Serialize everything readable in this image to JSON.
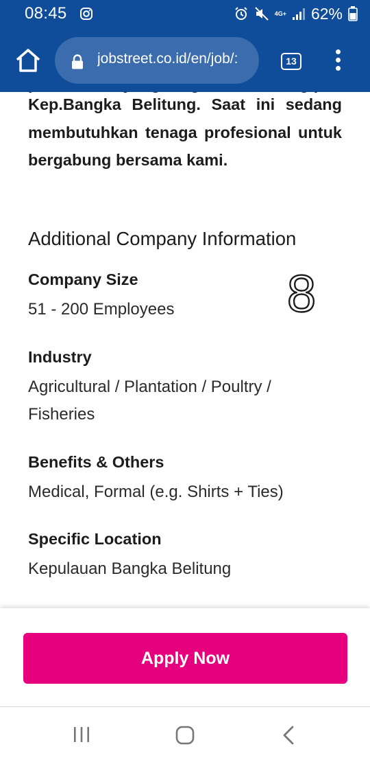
{
  "status_bar": {
    "time": "08:45",
    "network": "4G+",
    "battery": "62%"
  },
  "browser": {
    "url": "jobstreet.co.id/en/job/:",
    "tab_count": "13"
  },
  "content": {
    "intro_partial": "perusahaan yang bergerak di bidang perkebunan di",
    "intro_lines": "Kep.Bangka Belitung. Saat ini sedang membutuhkan tenaga profesional untuk bergabung bersama kami.",
    "section_title": "Additional Company Information",
    "annotation_number": "8",
    "fields": [
      {
        "label": "Company Size",
        "value": "51 - 200 Employees"
      },
      {
        "label": "Industry",
        "value": "Agricultural / Plantation / Poultry / Fisheries"
      },
      {
        "label": "Benefits & Others",
        "value": "Medical, Formal (e.g. Shirts + Ties)"
      },
      {
        "label": "Specific Location",
        "value": "Kepulauan Bangka Belitung"
      }
    ]
  },
  "apply": {
    "label": "Apply Now",
    "color": "#e6007e"
  },
  "colors": {
    "header": "#0f4c9a",
    "url_pill": "#3a6cae"
  },
  "icons": {
    "home": "home-icon",
    "lock": "lock-icon",
    "tabs": "tabs-counter-icon",
    "menu": "more-vertical-icon",
    "recents": "recents-icon",
    "nav_home": "nav-home-icon",
    "back": "back-icon"
  }
}
